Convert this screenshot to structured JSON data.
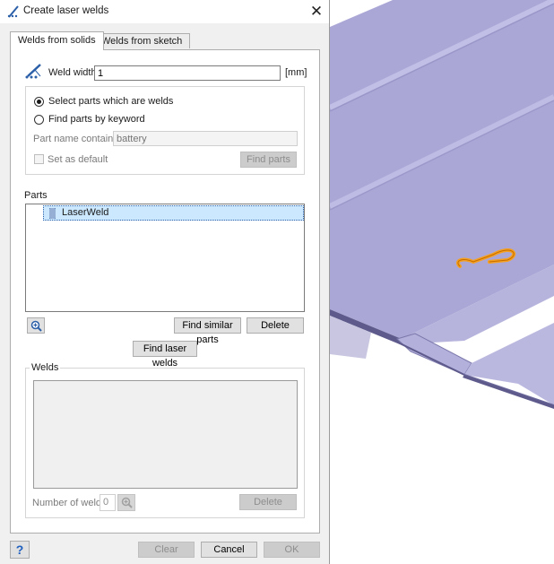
{
  "window": {
    "title": "Create laser welds",
    "close_symbol": "✕"
  },
  "tabs": [
    {
      "label": "Welds from solids",
      "active": true
    },
    {
      "label": "Welds from sketch",
      "active": false
    }
  ],
  "weld_width": {
    "label": "Weld width",
    "value": "1",
    "unit": "[mm]"
  },
  "selection_mode": {
    "options": [
      {
        "label": "Select parts which are welds",
        "checked": true
      },
      {
        "label": "Find parts by keyword",
        "checked": false
      }
    ],
    "part_name_label": "Part name contains:",
    "part_name_placeholder": "battery",
    "set_default_label": "Set as default",
    "find_parts_label": "Find parts"
  },
  "parts": {
    "title": "Parts",
    "items": [
      {
        "label": "LaserWeld",
        "selected": true
      }
    ],
    "find_similar_label": "Find similar parts",
    "delete_label": "Delete"
  },
  "find_laser_welds_label": "Find laser welds",
  "welds": {
    "title": "Welds",
    "count_label": "Number of welds",
    "count_value": "0",
    "delete_label": "Delete"
  },
  "footer": {
    "help_label": "?",
    "clear_label": "Clear",
    "cancel_label": "Cancel",
    "ok_label": "OK"
  },
  "colors": {
    "part_surface": "#a8a5d4",
    "part_shadow": "#6e6b9e",
    "weld_highlight": "#f5a020",
    "selection": "#cce8ff"
  }
}
